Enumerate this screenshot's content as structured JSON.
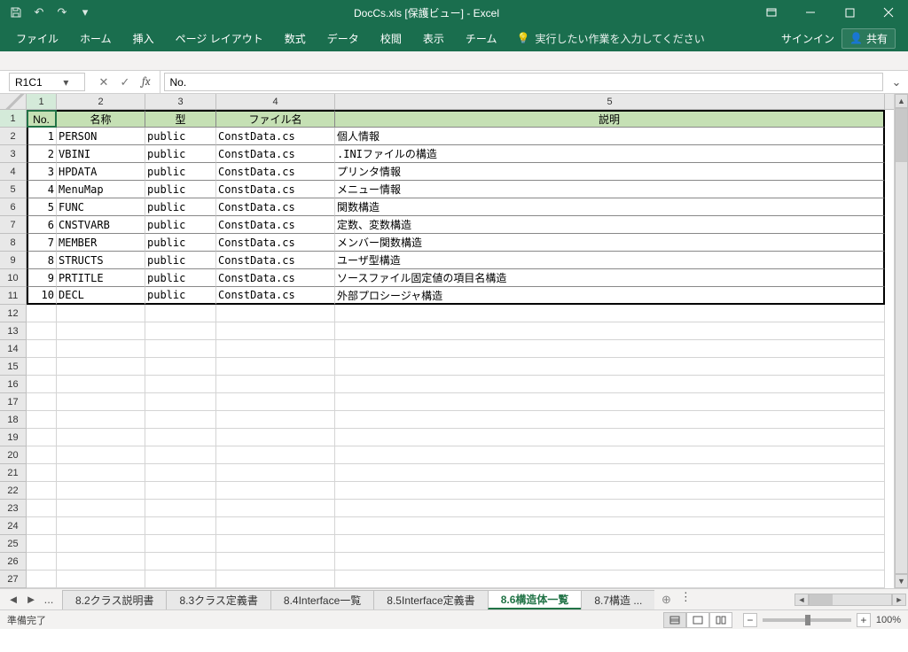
{
  "window": {
    "title": "DocCs.xls  [保護ビュー] - Excel",
    "sign_in": "サインイン",
    "share": "共有"
  },
  "ribbon": {
    "file": "ファイル",
    "home": "ホーム",
    "insert": "挿入",
    "page_layout": "ページ レイアウト",
    "formulas": "数式",
    "data": "データ",
    "review": "校閲",
    "view": "表示",
    "team": "チーム",
    "tell_me": "実行したい作業を入力してください"
  },
  "formula_bar": {
    "name_box": "R1C1",
    "formula": "No."
  },
  "columns": [
    "1",
    "2",
    "3",
    "4",
    "5"
  ],
  "headers": {
    "no": "No.",
    "name": "名称",
    "type": "型",
    "file": "ファイル名",
    "desc": "説明"
  },
  "rows": [
    {
      "no": "1",
      "name": "PERSON",
      "type": "public",
      "file": "ConstData.cs",
      "desc": "個人情報"
    },
    {
      "no": "2",
      "name": "VBINI",
      "type": "public",
      "file": "ConstData.cs",
      "desc": ".INIファイルの構造"
    },
    {
      "no": "3",
      "name": "HPDATA",
      "type": "public",
      "file": "ConstData.cs",
      "desc": "プリンタ情報"
    },
    {
      "no": "4",
      "name": "MenuMap",
      "type": "public",
      "file": "ConstData.cs",
      "desc": "メニュー情報"
    },
    {
      "no": "5",
      "name": "FUNC",
      "type": "public",
      "file": "ConstData.cs",
      "desc": "関数構造"
    },
    {
      "no": "6",
      "name": "CNSTVARB",
      "type": "public",
      "file": "ConstData.cs",
      "desc": "定数、変数構造"
    },
    {
      "no": "7",
      "name": "MEMBER",
      "type": "public",
      "file": "ConstData.cs",
      "desc": "メンバー関数構造"
    },
    {
      "no": "8",
      "name": "STRUCTS",
      "type": "public",
      "file": "ConstData.cs",
      "desc": "ユーザ型構造"
    },
    {
      "no": "9",
      "name": "PRTITLE",
      "type": "public",
      "file": "ConstData.cs",
      "desc": "ソースファイル固定値の項目名構造"
    },
    {
      "no": "10",
      "name": "DECL",
      "type": "public",
      "file": "ConstData.cs",
      "desc": "外部プロシージャ構造"
    }
  ],
  "empty_row_labels": [
    "12",
    "13",
    "14",
    "15",
    "16",
    "17",
    "18",
    "19",
    "20",
    "21",
    "22",
    "23",
    "24",
    "25",
    "26",
    "27"
  ],
  "data_row_labels": [
    "1",
    "2",
    "3",
    "4",
    "5",
    "6",
    "7",
    "8",
    "9",
    "10",
    "11"
  ],
  "sheet_tabs": {
    "ellipsis": "...",
    "tabs": [
      "8.2クラス説明書",
      "8.3クラス定義書",
      "8.4Interface一覧",
      "8.5Interface定義書",
      "8.6構造体一覧",
      "8.7構造 ..."
    ],
    "active_index": 4,
    "more": "..."
  },
  "status": {
    "ready": "準備完了",
    "zoom": "100%"
  }
}
